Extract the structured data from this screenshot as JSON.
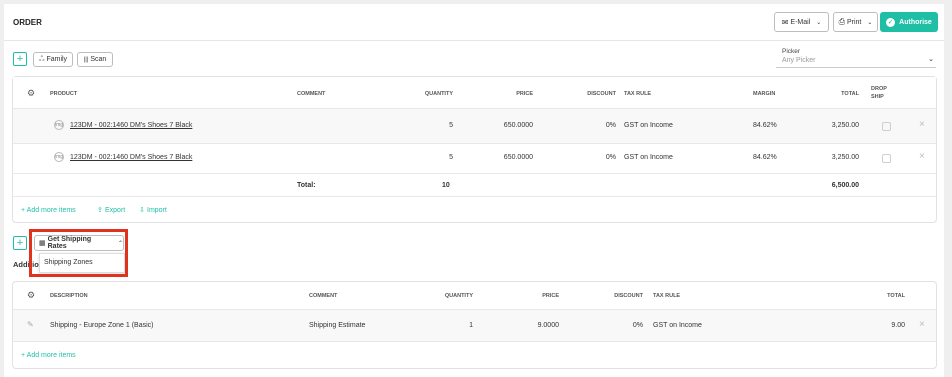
{
  "header": {
    "title": "ORDER",
    "email_label": "E-Mail",
    "print_label": "Print",
    "authorise_label": "Authorise"
  },
  "toolbar": {
    "add_label": "+",
    "family_label": "Family",
    "scan_label": "Scan"
  },
  "picker": {
    "label": "Picker",
    "placeholder": "Any Picker"
  },
  "items_table": {
    "columns": [
      "PRODUCT",
      "COMMENT",
      "QUANTITY",
      "PRICE",
      "DISCOUNT",
      "TAX RULE",
      "MARGIN",
      "TOTAL",
      "DROP SHIP"
    ],
    "rows": [
      {
        "product": "123DM - 002:1460 DM's Shoes 7 Black",
        "comment": "",
        "quantity": "5",
        "price": "650.0000",
        "discount": "0%",
        "tax_rule": "GST on Income",
        "margin": "84.62%",
        "total": "3,250.00"
      },
      {
        "product": "123DM - 002:1460 DM's Shoes 7 Black",
        "comment": "",
        "quantity": "5",
        "price": "650.0000",
        "discount": "0%",
        "tax_rule": "GST on Income",
        "margin": "84.62%",
        "total": "3,250.00"
      }
    ],
    "total_label": "Total:",
    "total_quantity": "10",
    "total_amount": "6,500.00",
    "add_more_label": "+ Add more items",
    "export_label": "Export",
    "import_label": "Import"
  },
  "shipping": {
    "add_label": "+",
    "get_rates_label": "Get Shipping Rates",
    "dropdown_item": "Shipping Zones",
    "section_title": "Additional"
  },
  "charges_table": {
    "columns": [
      "DESCRIPTION",
      "COMMENT",
      "QUANTITY",
      "PRICE",
      "DISCOUNT",
      "TAX RULE",
      "TOTAL"
    ],
    "rows": [
      {
        "description": "Shipping - Europe Zone 1 (Basic)",
        "comment": "Shipping Estimate",
        "quantity": "1",
        "price": "9.0000",
        "discount": "0%",
        "tax_rule": "GST on Income",
        "total": "9.00"
      }
    ],
    "add_more_label": "+ Add more items"
  },
  "colors": {
    "accent": "#1fbfa5",
    "highlight": "#e0321c"
  }
}
